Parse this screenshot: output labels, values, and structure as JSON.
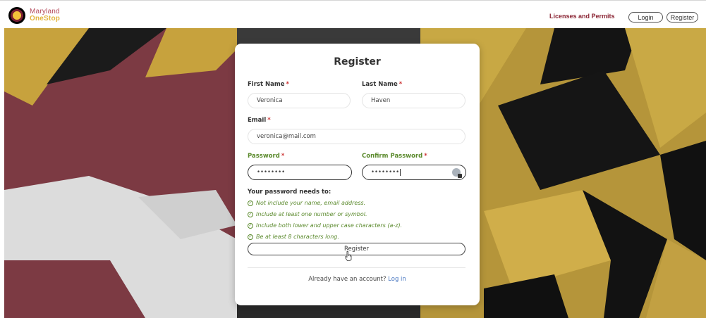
{
  "header": {
    "logo_line1": "Maryland",
    "logo_line2": "OneStop",
    "nav_link": "Licenses and Permits",
    "login_label": "Login",
    "register_label": "Register"
  },
  "form": {
    "title": "Register",
    "first_name": {
      "label": "First Name",
      "required": "*",
      "value": "Veronica"
    },
    "last_name": {
      "label": "Last Name",
      "required": "*",
      "value": "Haven"
    },
    "email": {
      "label": "Email",
      "required": "*",
      "value": "veronica@mail.com"
    },
    "password": {
      "label": "Password",
      "required": "*",
      "value": "••••••••"
    },
    "confirm_password": {
      "label": "Confirm Password",
      "required": "*",
      "value": "••••••••"
    },
    "requirements_title": "Your password needs to:",
    "requirements": [
      "Not include your name, email address.",
      "Include at least one number or symbol.",
      "Include both lower and upper case characters (a-z).",
      "Be at least 8 characters long."
    ],
    "submit_label": "Register",
    "footer_text": "Already have an account?",
    "footer_link": "Log in"
  },
  "colors": {
    "brand_maroon": "#8a2433",
    "valid_green": "#5b8a2d",
    "link_blue": "#4a78c2"
  }
}
